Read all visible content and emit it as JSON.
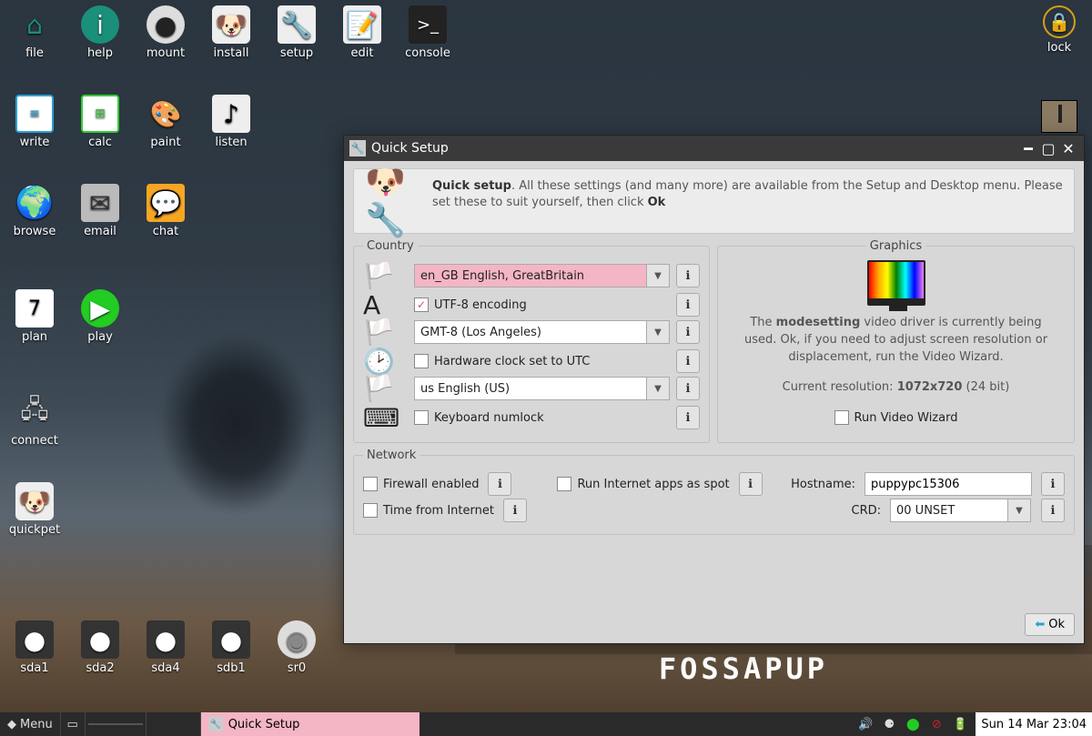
{
  "desktop": {
    "icons": [
      {
        "id": "file",
        "label": "file"
      },
      {
        "id": "help",
        "label": "help"
      },
      {
        "id": "mount",
        "label": "mount"
      },
      {
        "id": "install",
        "label": "install"
      },
      {
        "id": "setup",
        "label": "setup"
      },
      {
        "id": "edit",
        "label": "edit"
      },
      {
        "id": "console",
        "label": "console"
      },
      {
        "id": "write",
        "label": "write"
      },
      {
        "id": "calc",
        "label": "calc"
      },
      {
        "id": "paint",
        "label": "paint"
      },
      {
        "id": "listen",
        "label": "listen"
      },
      {
        "id": "browse",
        "label": "browse"
      },
      {
        "id": "email",
        "label": "email"
      },
      {
        "id": "chat",
        "label": "chat"
      },
      {
        "id": "plan",
        "label": "plan"
      },
      {
        "id": "play",
        "label": "play"
      },
      {
        "id": "connect",
        "label": "connect"
      },
      {
        "id": "quickpet",
        "label": "quickpet"
      },
      {
        "id": "lock",
        "label": "lock"
      }
    ],
    "drives": [
      {
        "id": "sda1",
        "label": "sda1"
      },
      {
        "id": "sda2",
        "label": "sda2"
      },
      {
        "id": "sda4",
        "label": "sda4"
      },
      {
        "id": "sdb1",
        "label": "sdb1"
      },
      {
        "id": "sr0",
        "label": "sr0"
      }
    ],
    "distro": "FOSSAPUP"
  },
  "window": {
    "title": "Quick Setup",
    "intro_bold": "Quick setup",
    "intro_text": ". All these settings (and many more) are available from the Setup and Desktop menu. Please set these to suit yourself, then click ",
    "intro_ok": "Ok",
    "country": {
      "legend": "Country",
      "locale": "en_GB     English, GreatBritain",
      "utf8": "UTF-8 encoding",
      "utf8_checked": true,
      "tz": "GMT-8     (Los Angeles)",
      "hwclock": "Hardware clock set to UTC",
      "hwclock_checked": false,
      "kb": "us          English (US)",
      "numlock": "Keyboard numlock",
      "numlock_checked": false
    },
    "graphics": {
      "legend": "Graphics",
      "text_pre": "The ",
      "driver": "modesetting",
      "text_post": " video driver is currently being used. Ok, if you need to adjust screen resolution or displacement, run the Video Wizard.",
      "res_label": "Current resolution: ",
      "res": "1072x720",
      "depth": "  (24 bit)",
      "wizard": "Run Video Wizard",
      "wizard_checked": false
    },
    "network": {
      "legend": "Network",
      "firewall": "Firewall enabled",
      "firewall_checked": false,
      "spot": "Run Internet apps as spot",
      "spot_checked": false,
      "host_label": "Hostname:",
      "host": "puppypc15306",
      "time": "Time from Internet",
      "time_checked": false,
      "crd_label": "CRD:",
      "crd": "00 UNSET"
    },
    "ok_label": "Ok"
  },
  "taskbar": {
    "menu": "Menu",
    "task": "Quick Setup",
    "clock": "Sun 14 Mar 23:04"
  }
}
